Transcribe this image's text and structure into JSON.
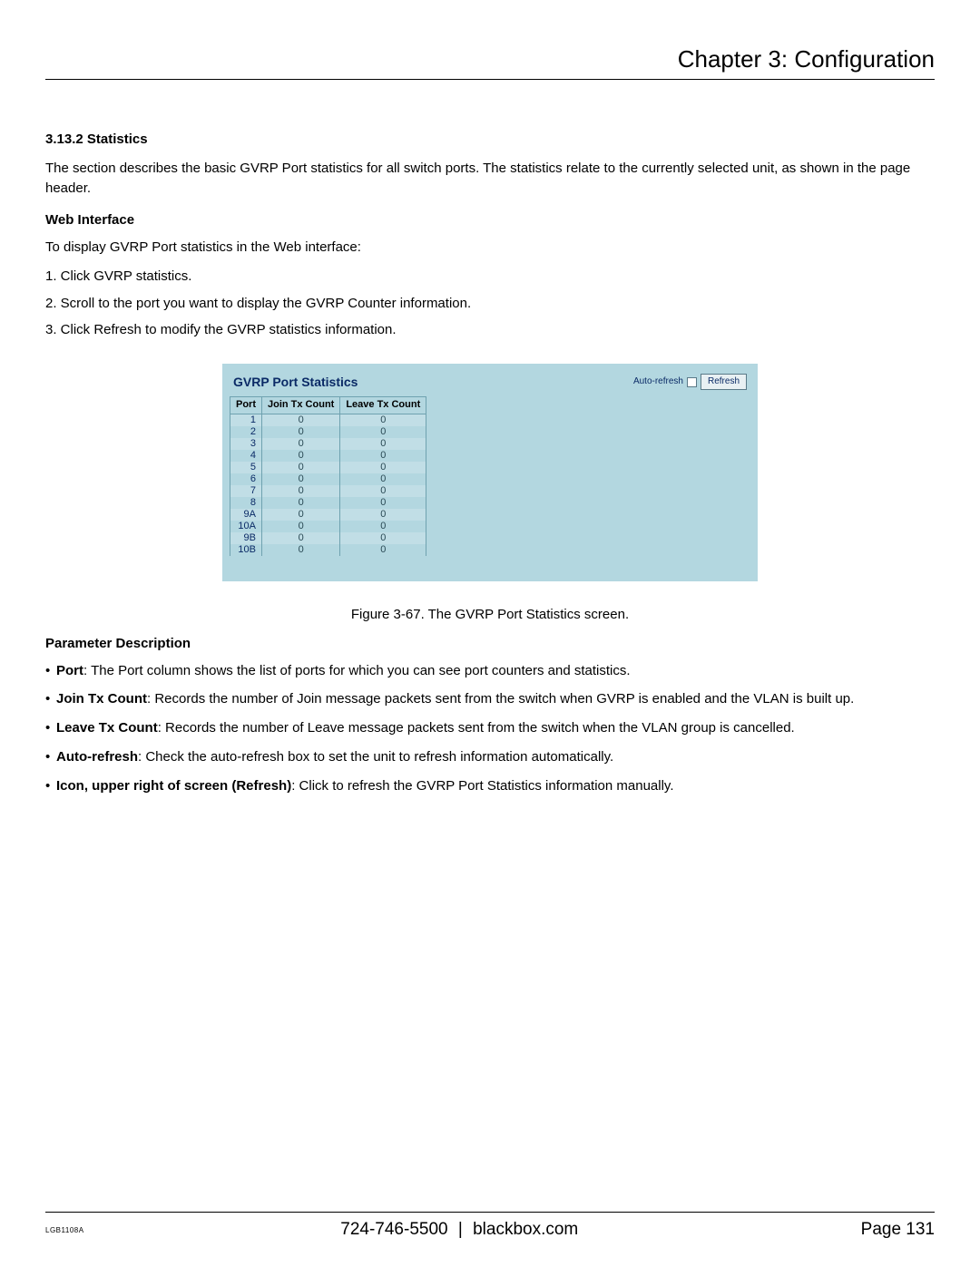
{
  "header": {
    "chapter": "Chapter 3: Configuration"
  },
  "section": {
    "number_title": "3.13.2 Statistics",
    "intro": "The section describes the basic GVRP Port statistics for all switch ports. The statistics relate to the currently selected unit, as shown in the page header.",
    "web_interface_head": "Web Interface",
    "web_interface_lead": "To display GVRP Port statistics in the Web interface:",
    "steps": [
      "1. Click GVRP statistics.",
      "2. Scroll to the port you want to display the GVRP Counter information.",
      "3. Click Refresh to modify the GVRP statistics information."
    ]
  },
  "panel": {
    "title": "GVRP Port Statistics",
    "auto_refresh_label": "Auto-refresh",
    "refresh_label": "Refresh",
    "columns": {
      "port": "Port",
      "join": "Join Tx Count",
      "leave": "Leave Tx Count"
    },
    "rows": [
      {
        "port": "1",
        "join": "0",
        "leave": "0"
      },
      {
        "port": "2",
        "join": "0",
        "leave": "0"
      },
      {
        "port": "3",
        "join": "0",
        "leave": "0"
      },
      {
        "port": "4",
        "join": "0",
        "leave": "0"
      },
      {
        "port": "5",
        "join": "0",
        "leave": "0"
      },
      {
        "port": "6",
        "join": "0",
        "leave": "0"
      },
      {
        "port": "7",
        "join": "0",
        "leave": "0"
      },
      {
        "port": "8",
        "join": "0",
        "leave": "0"
      },
      {
        "port": "9A",
        "join": "0",
        "leave": "0"
      },
      {
        "port": "10A",
        "join": "0",
        "leave": "0"
      },
      {
        "port": "9B",
        "join": "0",
        "leave": "0"
      },
      {
        "port": "10B",
        "join": "0",
        "leave": "0"
      }
    ]
  },
  "figure_caption": "Figure 3-67. The GVRP Port Statistics screen.",
  "param_title": "Parameter Description",
  "params": [
    {
      "term": "Port",
      "desc": ": The Port column shows the list of ports for which you can see port counters and statistics."
    },
    {
      "term": "Join Tx Count",
      "desc": ": Records the number of Join message packets sent from the switch when GVRP is enabled and the VLAN is built up."
    },
    {
      "term": "Leave Tx Count",
      "desc": ": Records the number of Leave message packets sent from the switch when the VLAN group is cancelled."
    },
    {
      "term": "Auto-refresh",
      "desc": ": Check the auto-refresh box to set the unit to refresh information automatically."
    },
    {
      "term": "Icon, upper right of screen (Refresh)",
      "desc": ": Click to refresh the GVRP Port Statistics information manually."
    }
  ],
  "footer": {
    "model": "LGB1108A",
    "phone": "724-746-5500",
    "sep": "|",
    "site": "blackbox.com",
    "page_label": "Page 131"
  }
}
